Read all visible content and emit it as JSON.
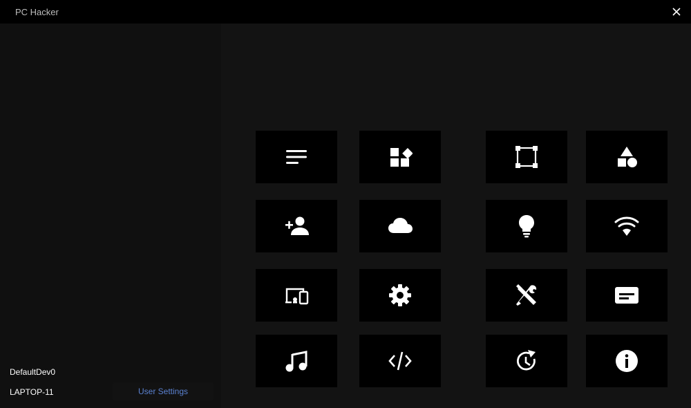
{
  "window": {
    "title": "PC Hacker",
    "close_icon": "close-icon"
  },
  "sidebar": {
    "device_name": "DefaultDev0",
    "host_name": "LAPTOP-11",
    "user_settings_label": "User Settings"
  },
  "colors": {
    "accent": "#5b82d1",
    "tile_bg": "#000000",
    "background": "#131313"
  },
  "tiles": [
    {
      "icon": "list-lines-icon"
    },
    {
      "icon": "apps-widgets-icon"
    },
    {
      "icon": "selection-square-icon"
    },
    {
      "icon": "shapes-icon"
    },
    {
      "icon": "add-user-icon"
    },
    {
      "icon": "cloud-icon"
    },
    {
      "icon": "lightbulb-icon"
    },
    {
      "icon": "wifi-icon"
    },
    {
      "icon": "devices-icon"
    },
    {
      "icon": "gear-icon"
    },
    {
      "icon": "tools-icon"
    },
    {
      "icon": "card-icon"
    },
    {
      "icon": "music-note-icon"
    },
    {
      "icon": "code-icon"
    },
    {
      "icon": "history-icon"
    },
    {
      "icon": "info-icon"
    }
  ]
}
